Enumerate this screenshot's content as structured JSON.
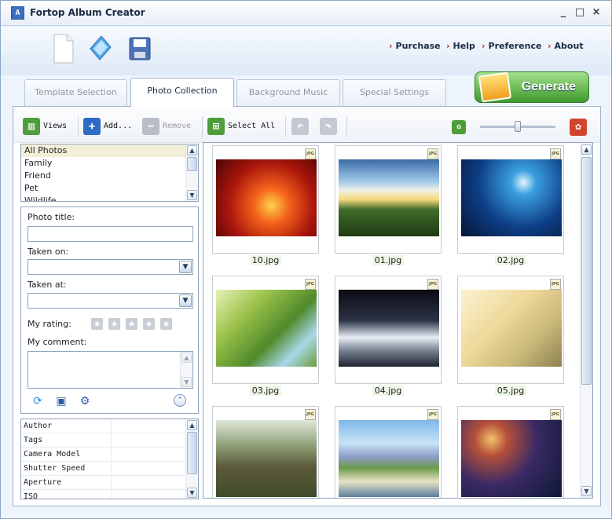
{
  "app": {
    "title": "Fortop Album Creator"
  },
  "window_controls": [
    "_",
    "□",
    "×"
  ],
  "top_links": [
    "Purchase",
    "Help",
    "Preference",
    "About"
  ],
  "tabs": [
    {
      "label": "Template Selection",
      "active": false
    },
    {
      "label": "Photo Collection",
      "active": true
    },
    {
      "label": "Background Music",
      "active": false
    },
    {
      "label": "Special Settings",
      "active": false
    }
  ],
  "generate_label": "Generate",
  "toolbar": {
    "views": "Views",
    "add": "Add...",
    "remove": "Remove",
    "select_all": "Select All"
  },
  "albums": [
    "All Photos",
    "Family",
    "Friend",
    "Pet",
    "Wildlife"
  ],
  "form": {
    "photo_title": "Photo title:",
    "taken_on": "Taken on:",
    "taken_at": "Taken at:",
    "my_rating": "My rating:",
    "rating": 0,
    "my_comment": "My comment:"
  },
  "properties": [
    "Author",
    "Tags",
    "Camera Model",
    "Shutter Speed",
    "Aperture",
    "ISO"
  ],
  "photos": [
    {
      "name": "10.jpg",
      "badge": "JPG"
    },
    {
      "name": "01.jpg",
      "badge": "JPG"
    },
    {
      "name": "02.jpg",
      "badge": "JPG"
    },
    {
      "name": "03.jpg",
      "badge": "JPG"
    },
    {
      "name": "04.jpg",
      "badge": "JPG"
    },
    {
      "name": "05.jpg",
      "badge": "JPG"
    },
    {
      "name": "",
      "badge": "JPG"
    },
    {
      "name": "",
      "badge": "JPG"
    },
    {
      "name": "",
      "badge": "JPG"
    }
  ]
}
